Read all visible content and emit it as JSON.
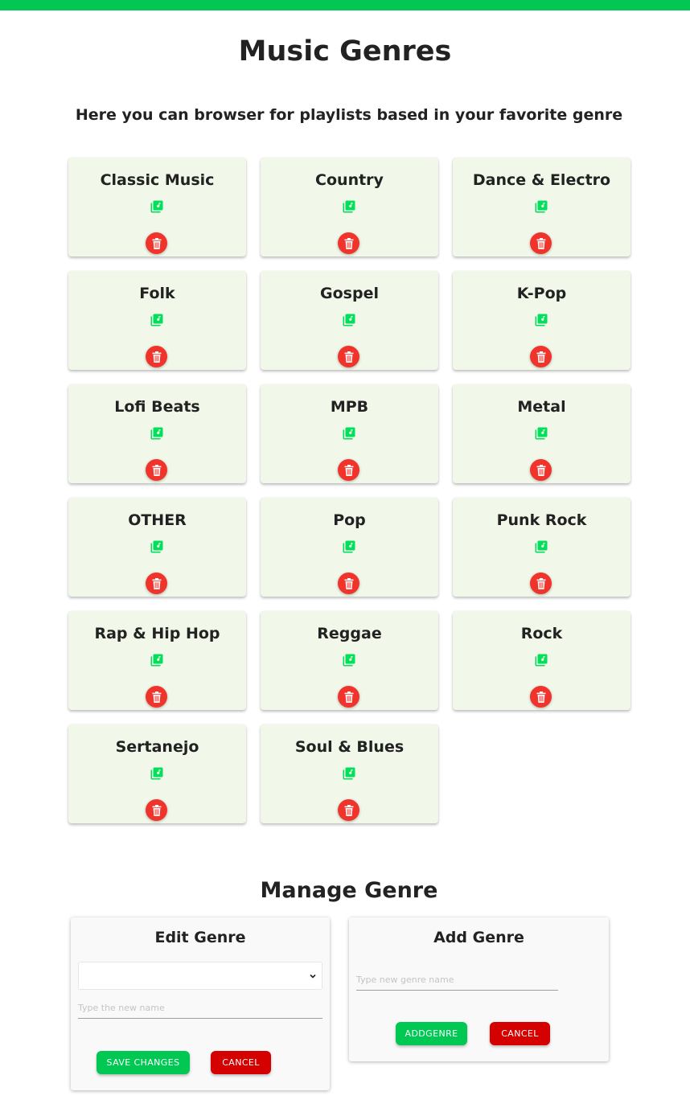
{
  "colors": {
    "accent": "#00c853",
    "danger": "#f0342b",
    "card_bg": "#f1f8e9"
  },
  "header": {
    "title": "Music Genres",
    "subtitle": "Here you can browser for playlists based in your favorite genre"
  },
  "genres": [
    {
      "name": "Classic Music"
    },
    {
      "name": "Country"
    },
    {
      "name": "Dance & Electro"
    },
    {
      "name": "Folk"
    },
    {
      "name": "Gospel"
    },
    {
      "name": "K-Pop"
    },
    {
      "name": "Lofi Beats"
    },
    {
      "name": "MPB"
    },
    {
      "name": "Metal"
    },
    {
      "name": "OTHER"
    },
    {
      "name": "Pop"
    },
    {
      "name": "Punk Rock"
    },
    {
      "name": "Rap & Hip Hop"
    },
    {
      "name": "Reggae"
    },
    {
      "name": "Rock"
    },
    {
      "name": "Sertanejo"
    },
    {
      "name": "Soul & Blues"
    }
  ],
  "card_icons": {
    "playlist": "playlist-music-icon",
    "delete": "trash-icon"
  },
  "manage": {
    "title": "Manage Genre",
    "edit": {
      "title": "Edit Genre",
      "select_value": "",
      "input_placeholder": "Type the new name",
      "input_value": "",
      "save_label": "SAVE CHANGES",
      "cancel_label": "CANCEL"
    },
    "add": {
      "title": "Add Genre",
      "input_placeholder": "Type new genre name",
      "input_value": "",
      "add_label": "ADDGENRE",
      "cancel_label": "CANCEL"
    }
  }
}
